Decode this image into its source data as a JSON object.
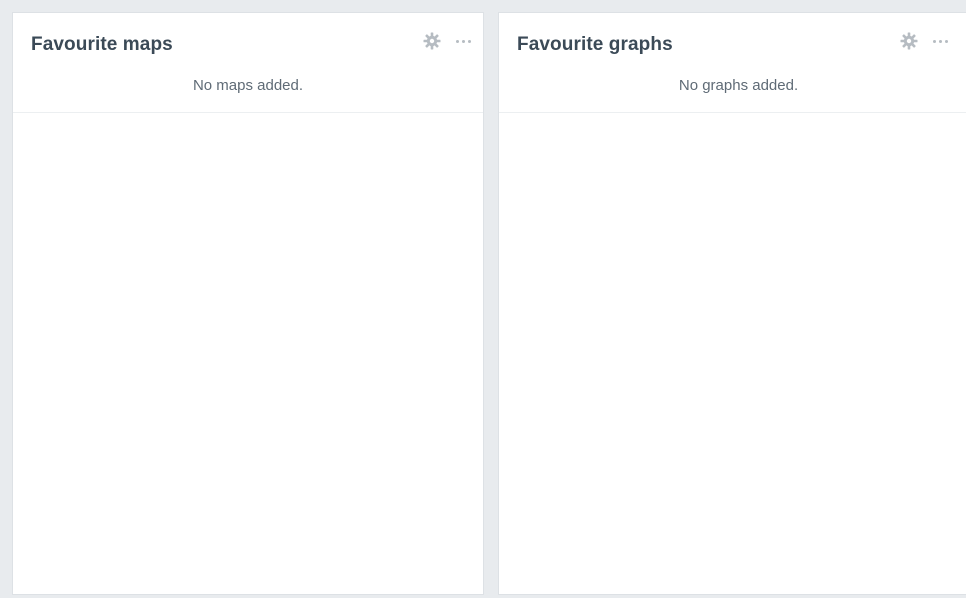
{
  "widgets": {
    "maps": {
      "title": "Favourite maps",
      "empty_text": "No maps added.",
      "settings_icon": "gear-icon",
      "more_icon": "more-horizontal-icon"
    },
    "graphs": {
      "title": "Favourite graphs",
      "empty_text": "No graphs added.",
      "settings_icon": "gear-icon",
      "more_icon": "more-horizontal-icon"
    }
  },
  "colors": {
    "page_background": "#e8ebee",
    "panel_background": "#ffffff",
    "title_text": "#3b4a57",
    "muted_text": "#5f6b76",
    "icon": "#b6bcc2"
  }
}
